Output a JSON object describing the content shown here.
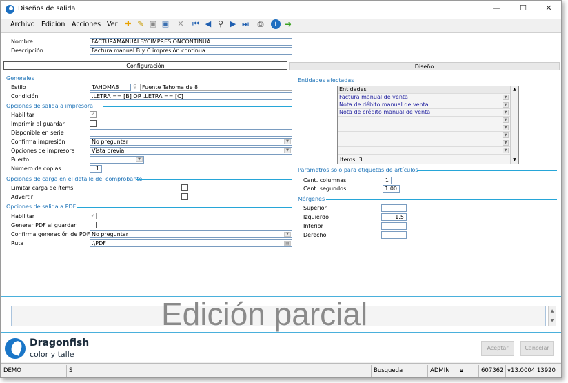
{
  "window": {
    "title": "Diseños de salida",
    "minimize": "—",
    "maximize": "☐",
    "close": "✕"
  },
  "menu": [
    "Archivo",
    "Edición",
    "Acciones",
    "Ver"
  ],
  "toolbar_icons": [
    "new-icon",
    "edit-icon",
    "save-icon",
    "save-as-icon",
    "delete-icon",
    "first-icon",
    "previous-icon",
    "search-icon",
    "next-icon",
    "last-icon",
    "preview-icon",
    "info-icon",
    "go-icon"
  ],
  "header": {
    "nombre_label": "Nombre",
    "nombre_value": "FACTURAMANUALBYCIMPRESIONCONTINUA",
    "descripcion_label": "Descripción",
    "descripcion_value": "Factura manual B y C impresión continua"
  },
  "tabs": {
    "configuracion": "Configuración",
    "diseno": "Diseño"
  },
  "generales": {
    "title": "Generales",
    "estilo_label": "Estilo",
    "estilo_value": "TAHOMA8",
    "estilo_desc": "Fuente Tahoma de 8",
    "condicion_label": "Condición",
    "condicion_value": ".LETRA == [B] OR .LETRA == [C]"
  },
  "impresora": {
    "title": "Opciones de salida a impresora",
    "habilitar": "Habilitar",
    "imprimir_guardar": "Imprimir al guardar",
    "disponible_serie": "Disponible en serie",
    "confirma_label": "Confirma impresión",
    "confirma_value": "No preguntar",
    "opciones_label": "Opciones de impresora",
    "opciones_value": "Vista previa",
    "puerto_label": "Puerto",
    "puerto_value": "",
    "copias_label": "Número de copias",
    "copias_value": "1"
  },
  "carga": {
    "title": "Opciones de carga en el detalle del comprobante",
    "limitar": "Limitar carga de ítems",
    "advertir": "Advertir"
  },
  "pdf": {
    "title": "Opciones de salida a PDF",
    "habilitar": "Habilitar",
    "generar": "Generar PDF al guardar",
    "confirma_label": "Confirma generación de PDF",
    "confirma_value": "No preguntar",
    "ruta_label": "Ruta",
    "ruta_value": ".\\PDF"
  },
  "entidades": {
    "title": "Entidades afectadas",
    "header": "Entidades",
    "items": [
      "Factura manual de venta",
      "Nota de débito manual de venta",
      "Nota de crédito manual de venta",
      "",
      "",
      "",
      "",
      "",
      ""
    ],
    "count": "Items: 3"
  },
  "etiquetas": {
    "title": "Parametros solo para etiquetas de artículos",
    "columnas_label": "Cant. columnas",
    "columnas_value": "1",
    "segundos_label": "Cant. segundos",
    "segundos_value": "1.00"
  },
  "margenes": {
    "title": "Márgenes",
    "superior": "Superior",
    "superior_value": "",
    "izquierdo": "Izquierdo",
    "izquierdo_value": "1.5",
    "inferior": "Inferior",
    "inferior_value": "",
    "derecho": "Derecho",
    "derecho_value": ""
  },
  "watermark": "Edición parcial",
  "brand": {
    "name": "Dragonfish",
    "tagline": "color y talle"
  },
  "buttons": {
    "aceptar": "Aceptar",
    "cancelar": "Cancelar"
  },
  "statusbar": {
    "mode": "DEMO",
    "s": "S",
    "busqueda": "Busqueda",
    "user": "ADMIN",
    "code": "607362",
    "version": "v13.0004.13920"
  }
}
